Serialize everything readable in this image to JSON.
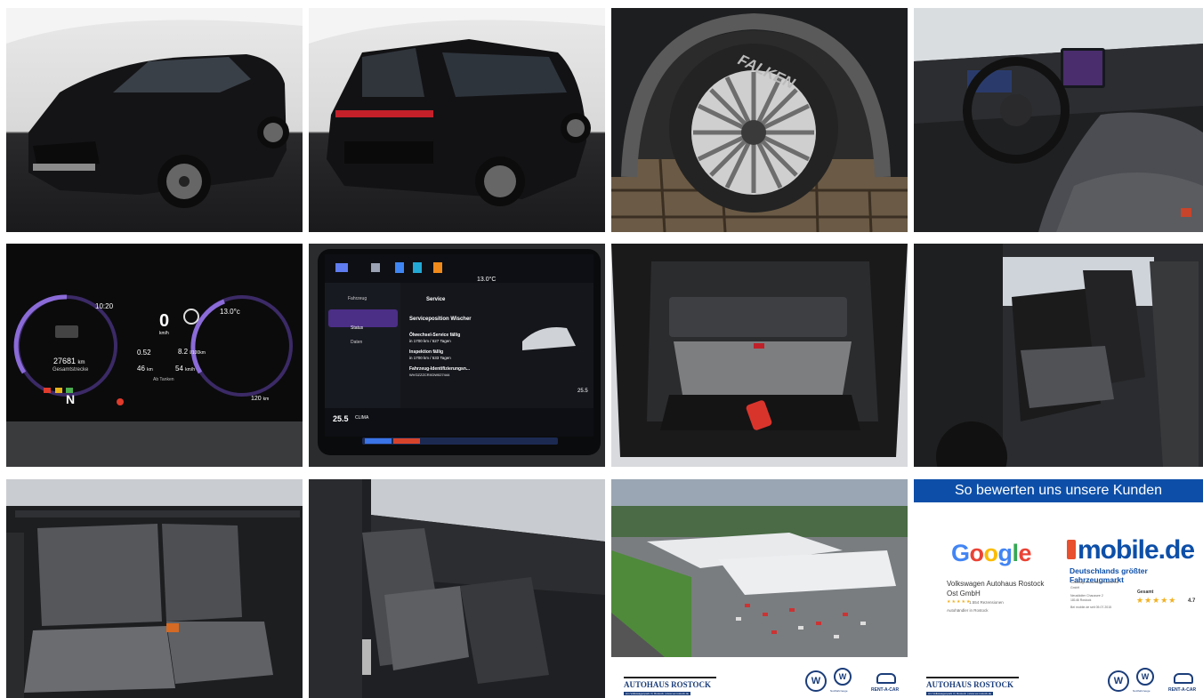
{
  "gallery": {
    "cluster": {
      "time": "10:20",
      "temp": "13.0°c",
      "speed": "0",
      "speed_unit": "km/h",
      "odometer": "27681",
      "odometer_unit": "km",
      "odometer_label": "Gesamtstrecke",
      "consumption": "0.52",
      "fuel_range": "8.2",
      "fuel_range_unit": "l/100km",
      "distance": "46",
      "distance_unit": "km",
      "avg_speed": "54",
      "avg_speed_unit": "km/h",
      "refuel_label": "Ab Tanken",
      "gear": "N",
      "range": "120",
      "range_unit": "km"
    },
    "infotainment": {
      "temp": "13.0°C",
      "menu_vehicle": "Fahrzeug",
      "menu_status": "Status",
      "menu_data": "Daten",
      "title": "Service",
      "wiper_service": "Serviceposition Wischer",
      "oil_service": "Ölwechsel-Service fällig",
      "oil_service_detail": "in 1700 km / 527 Tagen",
      "inspection": "Inspektion fällig",
      "inspection_detail": "in 1700 km / 533 Tagen",
      "vin_label": "Fahrzeug-Identifizierungsn...",
      "vin": "WVGZZZCRXDW027444",
      "temp_left": "25.5",
      "temp_right": "25.5",
      "climate_label": "CLIMA"
    },
    "tire_brand": "FALKEN",
    "dealer_footer": {
      "name": "AUTOHAUS ROSTOCK",
      "address": "Am Volkswagenpark 3 | Rostock | www.vw-rostock.de",
      "rentacar": "RENT-A-CAR",
      "service_label": "Nutzfahrzeuge"
    },
    "reviews": {
      "header": "So bewerten uns unsere Kunden",
      "google": "Google",
      "mobile": "mobile.de",
      "mobile_tagline": "Deutschlands größter Fahrzeugmarkt",
      "google_company": "Volkswagen Autohaus Rostock Ost GmbH",
      "google_score_line": "1.554 Rezensionen",
      "google_sub": "Autohändler in Rostock",
      "mobile_company_line1": "Volkswagen Autohaus Rostock Ost",
      "mobile_company_line2": "GmbH",
      "mobile_addr1": "Neustädter Chaussee 2",
      "mobile_addr2": "18146 Rostock",
      "mobile_since": "Bei mobile.de seit 05.07.2015",
      "overall_label": "Gesamt",
      "rating": "4.7"
    }
  },
  "colors": {
    "vw_blue": "#0d4fa8",
    "mobile_orange": "#e8502e",
    "star_gold": "#f2b01e"
  }
}
